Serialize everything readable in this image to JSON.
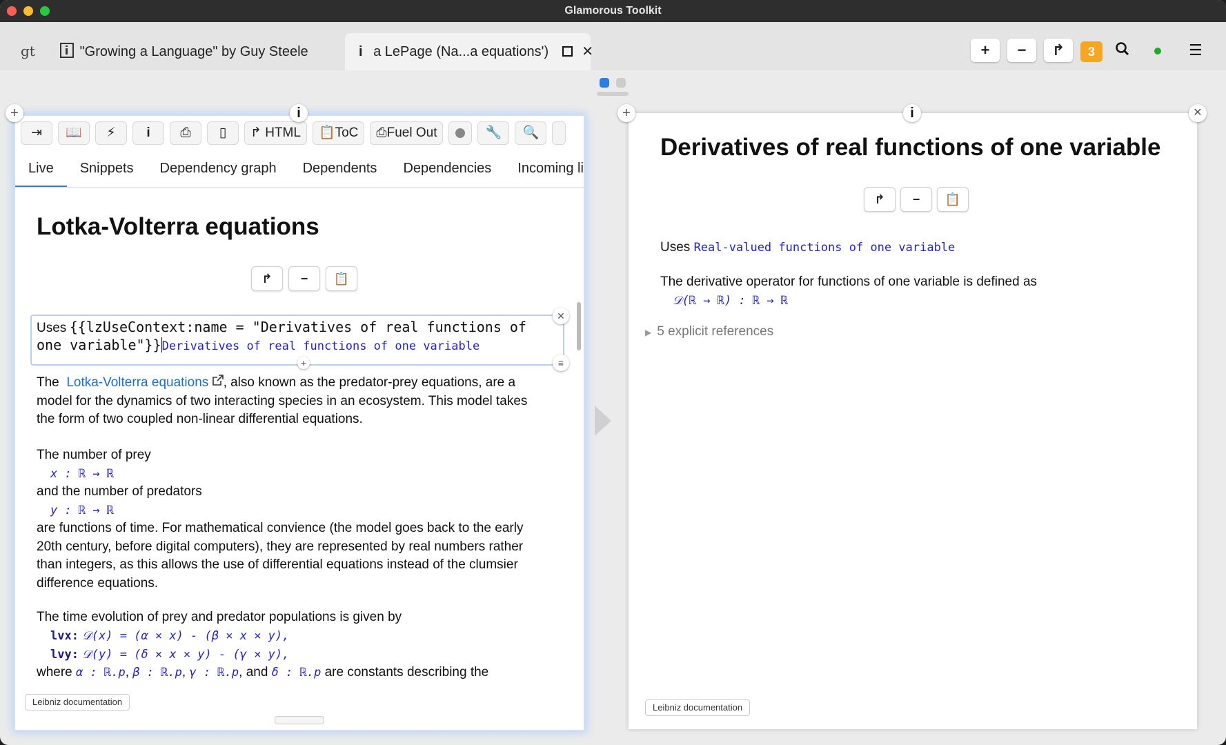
{
  "window": {
    "title": "Glamorous Toolkit"
  },
  "tabs": {
    "logo": "gt",
    "tab1_label": "\"Growing a Language\" by Guy Steele",
    "tab2_label": "a LePage (Na...a equations')"
  },
  "top_actions": {
    "badge_count": "3",
    "status_color": "#22aa22"
  },
  "left": {
    "toolbar": {
      "html_label": "HTML",
      "toc_label": "ToC",
      "fuelout_label": "Fuel Out"
    },
    "subtabs": [
      "Live",
      "Snippets",
      "Dependency graph",
      "Dependents",
      "Dependencies",
      "Incoming lir"
    ],
    "title": "Lotka-Volterra equations",
    "editor": {
      "prefix": "Uses",
      "source_line1": "{{lzUseContext:name = \"Derivatives of real functions of",
      "source_line2": "one variable\"}}",
      "rendered": "Derivatives of real functions of one variable"
    },
    "p1": {
      "the": "The",
      "link": "Lotka-Volterra equations",
      "rest": ", also known as the predator-prey equations, are a model for the dynamics of two interacting species in an ecosystem. This model takes the form of two coupled non-linear differential equations."
    },
    "p2_prey": "The number of prey",
    "math_x": "x : ℝ → ℝ",
    "p2_pred": "and the number of predators",
    "math_y": "y : ℝ → ℝ",
    "p3": "are functions of time. For mathematical convience (the model goes back to the early 20th century, before digital computers), they are represented by real numbers rather than integers, as this allows the use of differential equations instead of the clumsier difference equations.",
    "p4": "The time evolution of prey and predator populations is given by",
    "eq1_label": "lvx:",
    "eq1_body": "𝒟(x) = (α × x) - (β × x × y),",
    "eq2_label": "lvy:",
    "eq2_body": "𝒟(y) = (δ × x × y) - (γ × y),",
    "p5": {
      "where": "where",
      "alpha": "α : ℝ.p",
      "beta": "β : ℝ.p",
      "gamma": "γ : ℝ.p",
      "and": "and",
      "delta": "δ : ℝ.p",
      "tail": "are constants describing the"
    },
    "footer": "Leibniz documentation"
  },
  "right": {
    "title": "Derivatives of real functions of one variable",
    "uses_prefix": "Uses",
    "uses_link": "Real-valued functions of one variable",
    "p1": "The derivative operator for functions of one variable is defined as",
    "math": "𝒟(ℝ → ℝ) : ℝ → ℝ",
    "refs": "5 explicit references",
    "footer": "Leibniz documentation"
  }
}
